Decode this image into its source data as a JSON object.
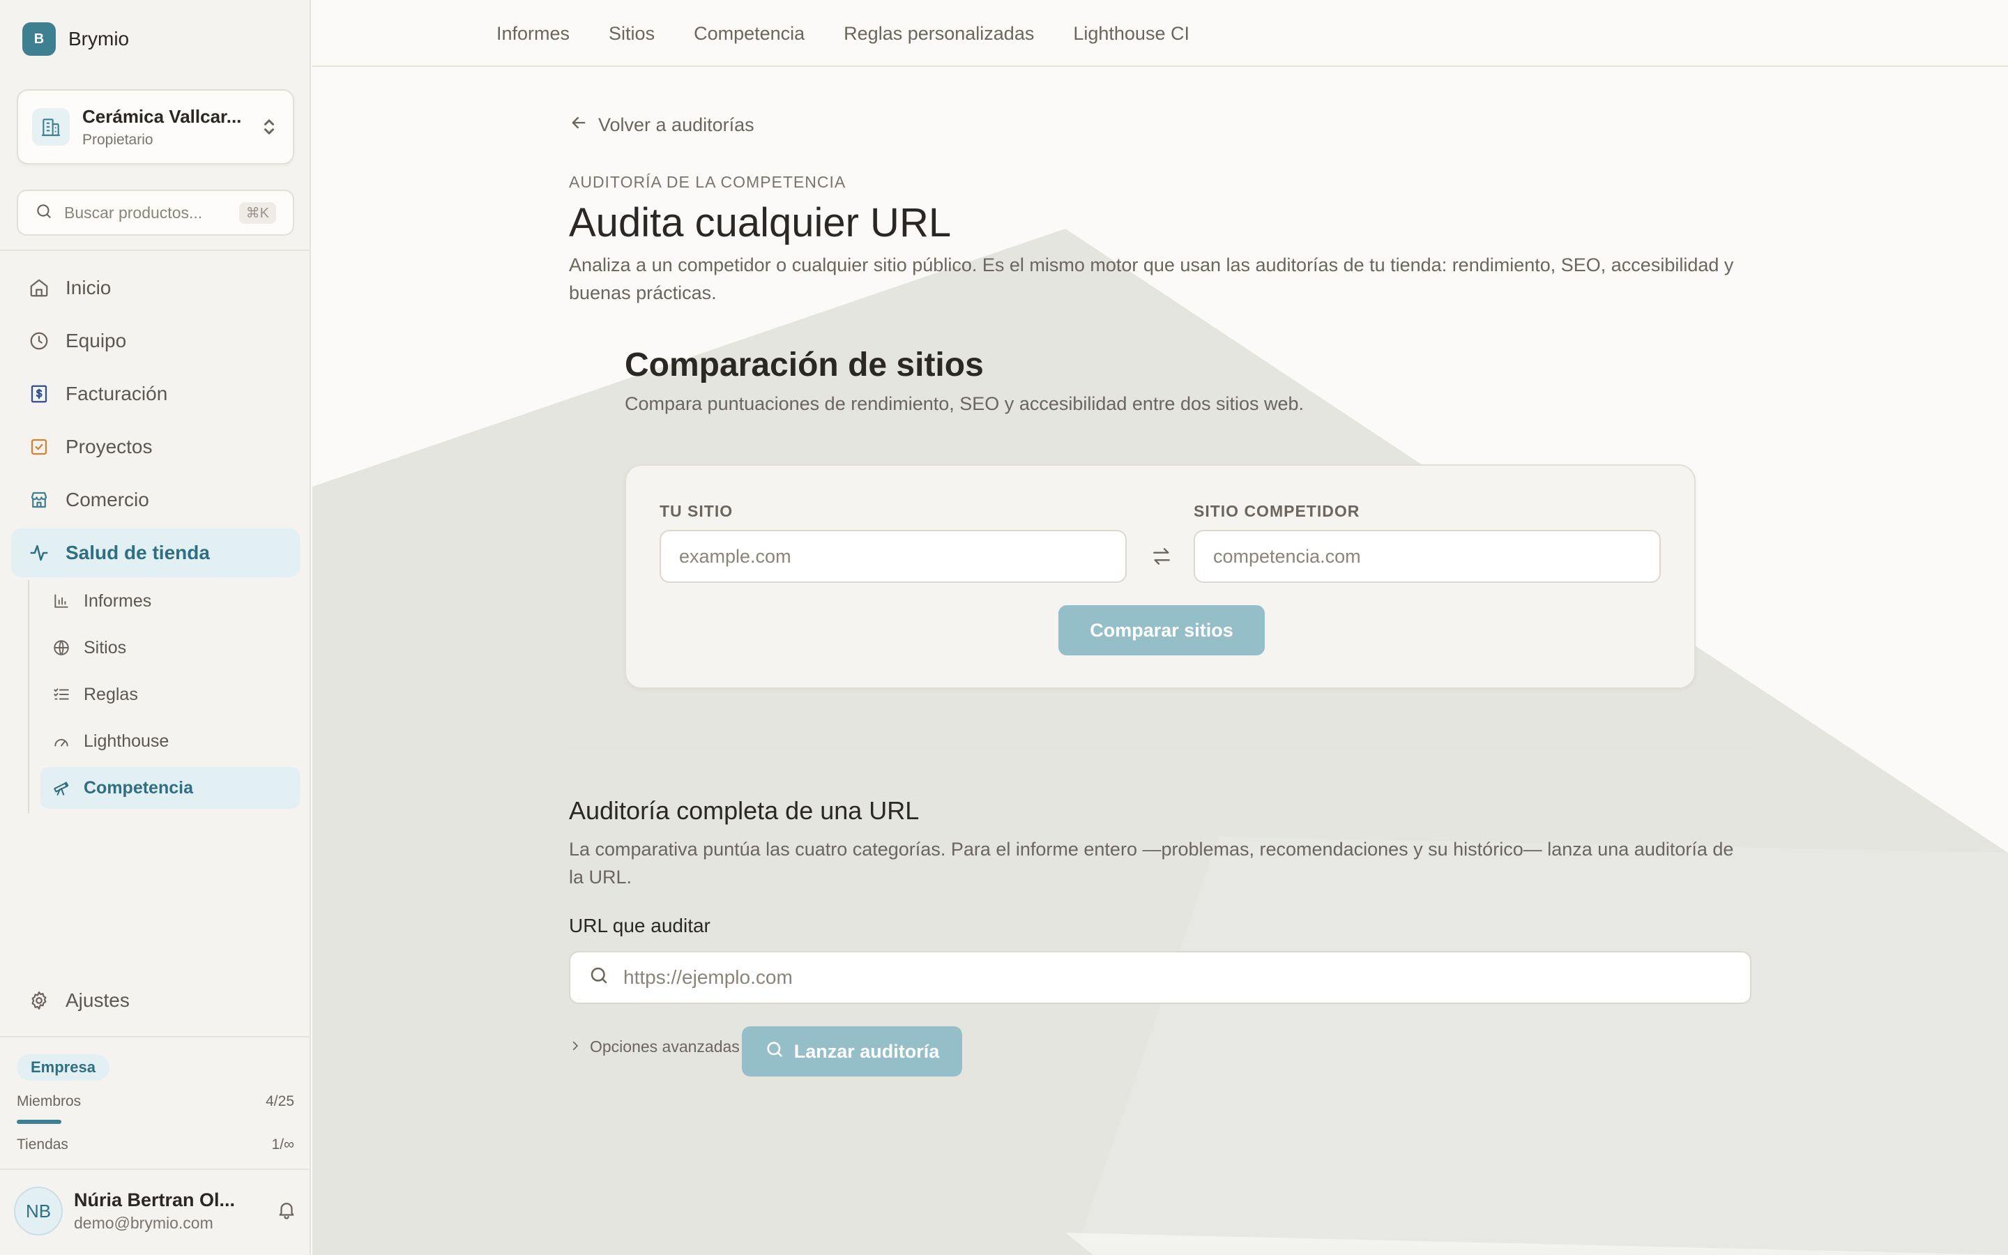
{
  "brand": {
    "logo_letter": "B",
    "name": "Brymio"
  },
  "org": {
    "name": "Cerámica Vallcar...",
    "role": "Propietario"
  },
  "search": {
    "placeholder": "Buscar productos...",
    "shortcut": "⌘K"
  },
  "nav": {
    "items": [
      {
        "label": "Inicio",
        "icon": "home-icon"
      },
      {
        "label": "Equipo",
        "icon": "clock-icon"
      },
      {
        "label": "Facturación",
        "icon": "invoice-icon"
      },
      {
        "label": "Proyectos",
        "icon": "checkbox-icon"
      },
      {
        "label": "Comercio",
        "icon": "store-icon"
      },
      {
        "label": "Salud de tienda",
        "icon": "activity-icon",
        "active": true
      }
    ],
    "sub_items": [
      {
        "label": "Informes",
        "icon": "bar-chart-icon"
      },
      {
        "label": "Sitios",
        "icon": "globe-icon"
      },
      {
        "label": "Reglas",
        "icon": "list-check-icon"
      },
      {
        "label": "Lighthouse",
        "icon": "gauge-icon"
      },
      {
        "label": "Competencia",
        "icon": "telescope-icon",
        "active": true
      }
    ],
    "settings_label": "Ajustes"
  },
  "plan": {
    "badge": "Empresa",
    "members_label": "Miembros",
    "members_value": "4/25",
    "members_fraction": 0.16,
    "stores_label": "Tiendas",
    "stores_value": "1/∞"
  },
  "user": {
    "initials": "NB",
    "name": "Núria Bertran Ol...",
    "email": "demo@brymio.com"
  },
  "topnav": [
    "Informes",
    "Sitios",
    "Competencia",
    "Reglas personalizadas",
    "Lighthouse CI"
  ],
  "page": {
    "back_label": "Volver a auditorías",
    "eyebrow": "AUDITORÍA DE LA COMPETENCIA",
    "title": "Audita cualquier URL",
    "description": "Analiza a un competidor o cualquier sitio público. Es el mismo motor que usan las auditorías de tu tienda: rendimiento, SEO, accesibilidad y buenas prácticas."
  },
  "comparison": {
    "title": "Comparación de sitios",
    "description": "Compara puntuaciones de rendimiento, SEO y accesibilidad entre dos sitios web.",
    "your_site_label": "TU SITIO",
    "your_site_placeholder": "example.com",
    "competitor_label": "SITIO COMPETIDOR",
    "competitor_placeholder": "competencia.com",
    "button_label": "Comparar sitios"
  },
  "full_audit": {
    "title": "Auditoría completa de una URL",
    "description": "La comparativa puntúa las cuatro categorías. Para el informe entero —problemas, recomendaciones y su histórico— lanza una auditoría de la URL.",
    "url_label": "URL que auditar",
    "url_placeholder": "https://ejemplo.com",
    "advanced_label": "Opciones avanzadas",
    "button_label": "Lanzar auditoría"
  },
  "colors": {
    "accent": "#3e7f91",
    "active_bg": "#e3f0f3",
    "button_disabled": "#94bfc9"
  }
}
